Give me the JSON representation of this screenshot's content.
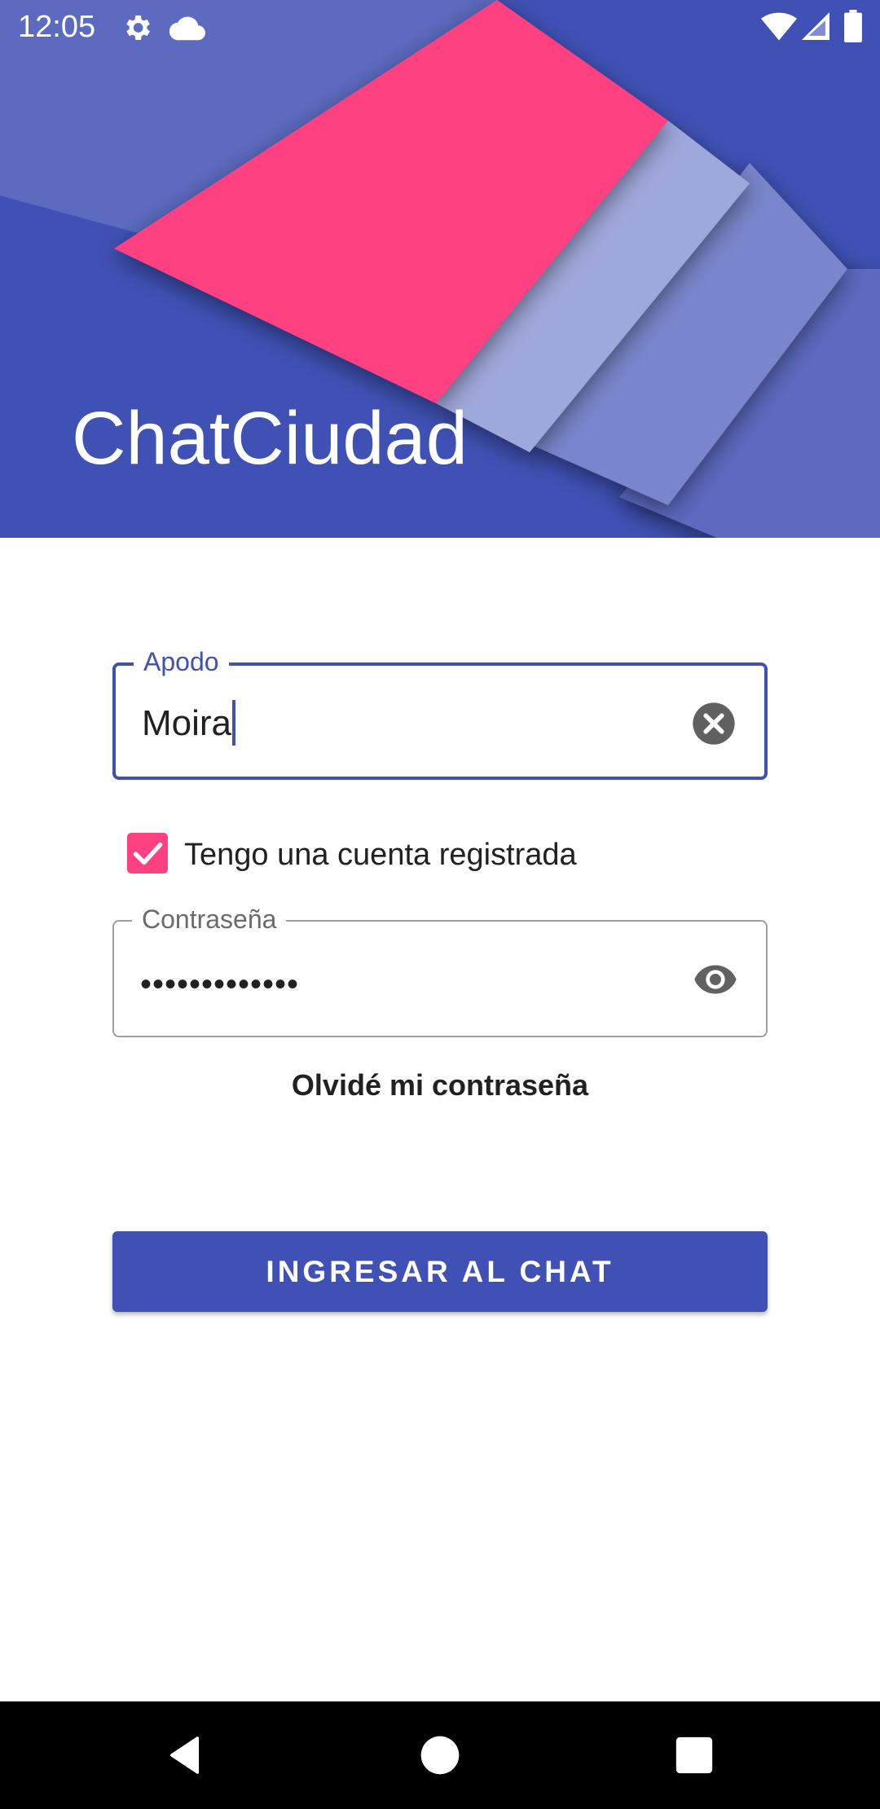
{
  "status_bar": {
    "time": "12:05",
    "icons": [
      "settings-icon",
      "cloud-icon",
      "wifi-icon",
      "signal-icon",
      "battery-icon"
    ]
  },
  "header": {
    "title": "ChatCiudad"
  },
  "form": {
    "nickname": {
      "label": "Apodo",
      "value": "Moira"
    },
    "registered_checkbox": {
      "label": "Tengo una cuenta registrada",
      "checked": true
    },
    "password": {
      "label": "Contraseña",
      "value": "•••••••••••••"
    },
    "forgot_password": "Olvidé mi contraseña",
    "submit_label": "INGRESAR AL CHAT"
  },
  "nav_bar": {
    "buttons": [
      "back-icon",
      "home-icon",
      "recents-icon"
    ]
  },
  "colors": {
    "primary": "#3f51b5",
    "accent": "#ff4081"
  }
}
